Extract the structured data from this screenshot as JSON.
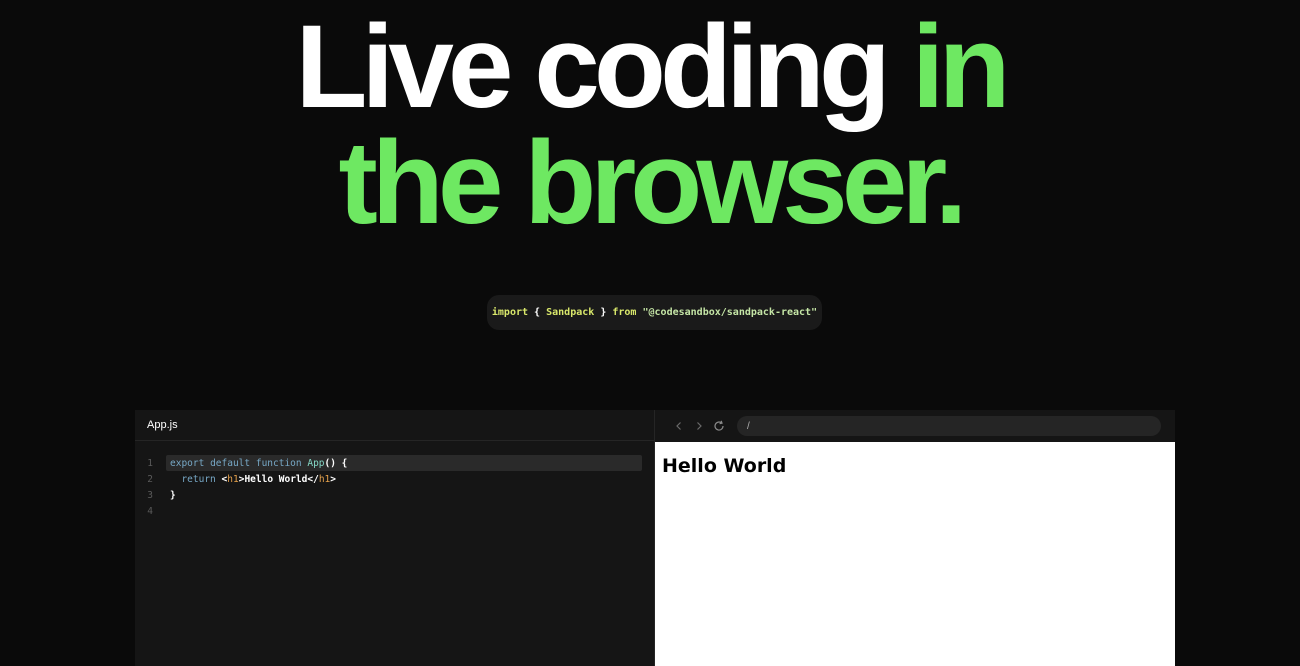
{
  "hero": {
    "line1_white": "Live coding ",
    "line1_green": "in",
    "line2": "the browser."
  },
  "import_snippet": {
    "kw_import": "import",
    "brace_open": "{",
    "identifier": "Sandpack",
    "brace_close": "}",
    "kw_from": "from",
    "module": "\"@codesandbox/sandpack-react\""
  },
  "editor": {
    "tab_label": "App.js",
    "lines": [
      {
        "number": "1"
      },
      {
        "number": "2"
      },
      {
        "number": "3"
      },
      {
        "number": "4"
      }
    ],
    "line1": {
      "kw1": "export",
      "kw2": "default",
      "kw3": "function",
      "fn": "App",
      "rest": "() {"
    },
    "line2": {
      "kw": "return",
      "lt": "<",
      "tag_open": "h1",
      "gt": ">",
      "text": "Hello World",
      "lt2": "</",
      "tag_close": "h1",
      "gt2": ">"
    },
    "line3": {
      "text": "}"
    }
  },
  "preview": {
    "url": "/",
    "heading": "Hello World"
  },
  "colors": {
    "accent": "#6ee862",
    "background": "#0a0a0a",
    "panel": "#151515"
  },
  "icons": [
    "chevron-left-icon",
    "chevron-right-icon",
    "refresh-icon"
  ]
}
